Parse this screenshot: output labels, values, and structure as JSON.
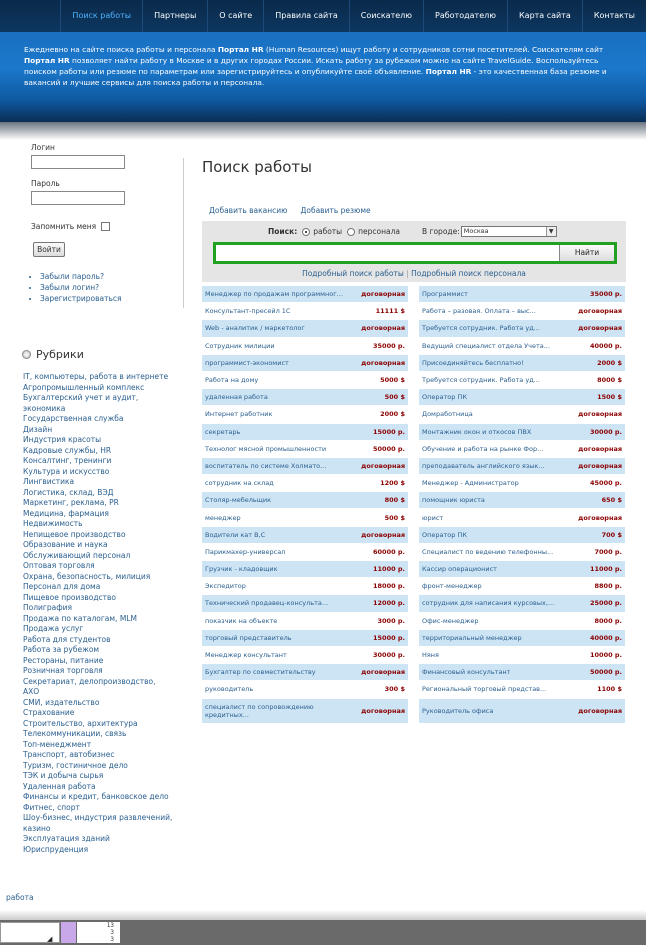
{
  "nav": {
    "items": [
      "Поиск работы",
      "Партнеры",
      "О сайте",
      "Правила сайта",
      "Соискателю",
      "Работодателю",
      "Карта сайта",
      "Контакты"
    ],
    "active": 0
  },
  "banner": {
    "t1": "Ежедневно на сайте поиска работы и персонала ",
    "b1": "Портал HR",
    "t2": " (Human Resources) ищут работу и сотрудников сотни посетителей.  Соискателям сайт ",
    "b2": "Портал HR",
    "t3": " позволяет найти работу в Москве и в других городах России. Искать работу за рубежом можно на сайте TravelGuide. Воспользуйтесь поиском работы или резюме по параметрам или зарегистрируйтесь и опубликуйте своё объявление.  ",
    "b3": "Портал HR",
    "t4": " - это качественная база резюме и вакансий и лучшие сервисы для поиска работы и персонала."
  },
  "login": {
    "login_label": "Логин",
    "password_label": "Пароль",
    "remember_label": "Запомнить меня",
    "button": "Войти",
    "links": [
      "Забыли пароль?",
      "Забыли логин?",
      "Зарегистрироваться"
    ]
  },
  "rubrics": {
    "title": "Рубрики",
    "items": [
      "IT, компьютеры, работа в интернете",
      "Агропромышленный комплекс",
      "Бухгалтерский учет и аудит, экономика",
      "Государственная служба",
      "Дизайн",
      "Индустрия красоты",
      "Кадровые службы, HR",
      "Консалтинг, тренинги",
      "Культура и искусство",
      "Лингвистика",
      "Логистика, склад, ВЭД",
      "Маркетинг, реклама, PR",
      "Медицина, фармация",
      "Недвижимость",
      "Непищевое производство",
      "Образование и наука",
      "Обслуживающий персонал",
      "Оптовая торговля",
      "Охрана, безопасность, милиция",
      "Персонал для дома",
      "Пищевое производство",
      "Полиграфия",
      "Продажа по каталогам, MLM",
      "Продажа услуг",
      "Работа для студентов",
      "Работа за рубежом",
      "Рестораны, питание",
      "Розничная торговля",
      "Секретариат, делопроизводство, АХО",
      "СМИ, издательство",
      "Страхование",
      "Строительство, архитектура",
      "Телекоммуникации, связь",
      "Топ-менеджмент",
      "Транспорт, автобизнес",
      "Туризм, гостиничное дело",
      "ТЭК и добыча сырья",
      "Удаленная работа",
      "Финансы и кредит, банковское дело",
      "Фитнес, спорт",
      "Шоу-бизнес, индустрия развлечений, казино",
      "Эксплуатация зданий",
      "Юриспруденция"
    ]
  },
  "footer_link": "работа",
  "main": {
    "title": "Поиск работы",
    "add_vacancy": "Добавить вакансию",
    "add_resume": "Добавить резюме",
    "search_label": "Поиск:",
    "radio_jobs": "работы",
    "radio_personnel": "персонала",
    "city_label": "В городе:",
    "city_value": "Москва",
    "find_button": "Найти",
    "adv_jobs": "Подробный поиск работы",
    "adv_sep": "|",
    "adv_personnel": "Подробный поиск персонала"
  },
  "jobs_left": [
    {
      "title": "Менеджер по продажам программного...",
      "salary": "договорная"
    },
    {
      "title": "Консультант-пресейл 1С",
      "salary": "11111 $"
    },
    {
      "title": "Web - аналитик / маркетолог",
      "salary": "договорная"
    },
    {
      "title": "Сотрудник милиции",
      "salary": "35000 р."
    },
    {
      "title": "программист-экономист",
      "salary": "договорная"
    },
    {
      "title": "Работа на дому",
      "salary": "5000 $"
    },
    {
      "title": "удаленная работа",
      "salary": "500 $"
    },
    {
      "title": "Интернет работник",
      "salary": "2000 $"
    },
    {
      "title": "секретарь",
      "salary": "15000 р."
    },
    {
      "title": "Технолог мясной промышленности",
      "salary": "50000 р."
    },
    {
      "title": "воспитатель по системе Холмато...",
      "salary": "договорная"
    },
    {
      "title": "сотрудник на склад",
      "salary": "1200 $"
    },
    {
      "title": "Столяр-мебельщик",
      "salary": "800 $"
    },
    {
      "title": "менеджер",
      "salary": "500 $"
    },
    {
      "title": "Водители кат В,С",
      "salary": "договорная"
    },
    {
      "title": "Парикмахер-универсал",
      "salary": "60000 р."
    },
    {
      "title": "Грузчик - кладовщик",
      "salary": "11000 р."
    },
    {
      "title": "Экспедитор",
      "salary": "18000 р."
    },
    {
      "title": "Технический продавец-консульта...",
      "salary": "12000 р."
    },
    {
      "title": "показчик на объекте",
      "salary": "3000 р."
    },
    {
      "title": "торговый представитель",
      "salary": "15000 р."
    },
    {
      "title": "Менеджер консультант",
      "salary": "30000 р."
    },
    {
      "title": "Бухгалтер по совместительству",
      "salary": "договорная"
    },
    {
      "title": "руководитель",
      "salary": "300 $"
    },
    {
      "title": "специалист по сопровождению кредитных...",
      "salary": "договорная"
    }
  ],
  "jobs_right": [
    {
      "title": "Программист",
      "salary": "35000 р."
    },
    {
      "title": "Работа – разовая. Оплата – выс...",
      "salary": "договорная"
    },
    {
      "title": "Требуется сотрудник. Работа уд...",
      "salary": "договорная"
    },
    {
      "title": "Ведущий специалист отдела Учета...",
      "salary": "40000 р."
    },
    {
      "title": "Присоединяйтесь бесплатно!",
      "salary": "2000 $"
    },
    {
      "title": "Требуется сотрудник. Работа уд...",
      "salary": "8000 $"
    },
    {
      "title": "Оператор ПК",
      "salary": "1500 $"
    },
    {
      "title": "Домработница",
      "salary": "договорная"
    },
    {
      "title": "Монтажник окон и откосов ПВХ",
      "salary": "30000 р."
    },
    {
      "title": "Обучение и работа на рынке Фор...",
      "salary": "договорная"
    },
    {
      "title": "преподаватель английского язык...",
      "salary": "договорная"
    },
    {
      "title": "Менеджер - Администратор",
      "salary": "45000 р."
    },
    {
      "title": "помощник юриста",
      "salary": "650 $"
    },
    {
      "title": "юрист",
      "salary": "договорная"
    },
    {
      "title": "Оператор ПК",
      "salary": "700 $"
    },
    {
      "title": "Специалист по ведению телефонны...",
      "salary": "7000 р."
    },
    {
      "title": "Кассир операционист",
      "salary": "11000 р."
    },
    {
      "title": "фронт-менеджер",
      "salary": "8800 р."
    },
    {
      "title": "сотрудник для написания курсовых,...",
      "salary": "25000 р."
    },
    {
      "title": "Офис-менеджер",
      "salary": "8000 р."
    },
    {
      "title": "территориальный менеджер",
      "salary": "40000 р."
    },
    {
      "title": "Няня",
      "salary": "10000 р."
    },
    {
      "title": "Финансовый консультант",
      "salary": "50000 р."
    },
    {
      "title": "Региональный торговый представ...",
      "salary": "1100 $"
    },
    {
      "title": "Руководитель офиса",
      "salary": "договорная"
    }
  ],
  "bottombar": {
    "lines": [
      "13",
      "3",
      "3"
    ]
  }
}
